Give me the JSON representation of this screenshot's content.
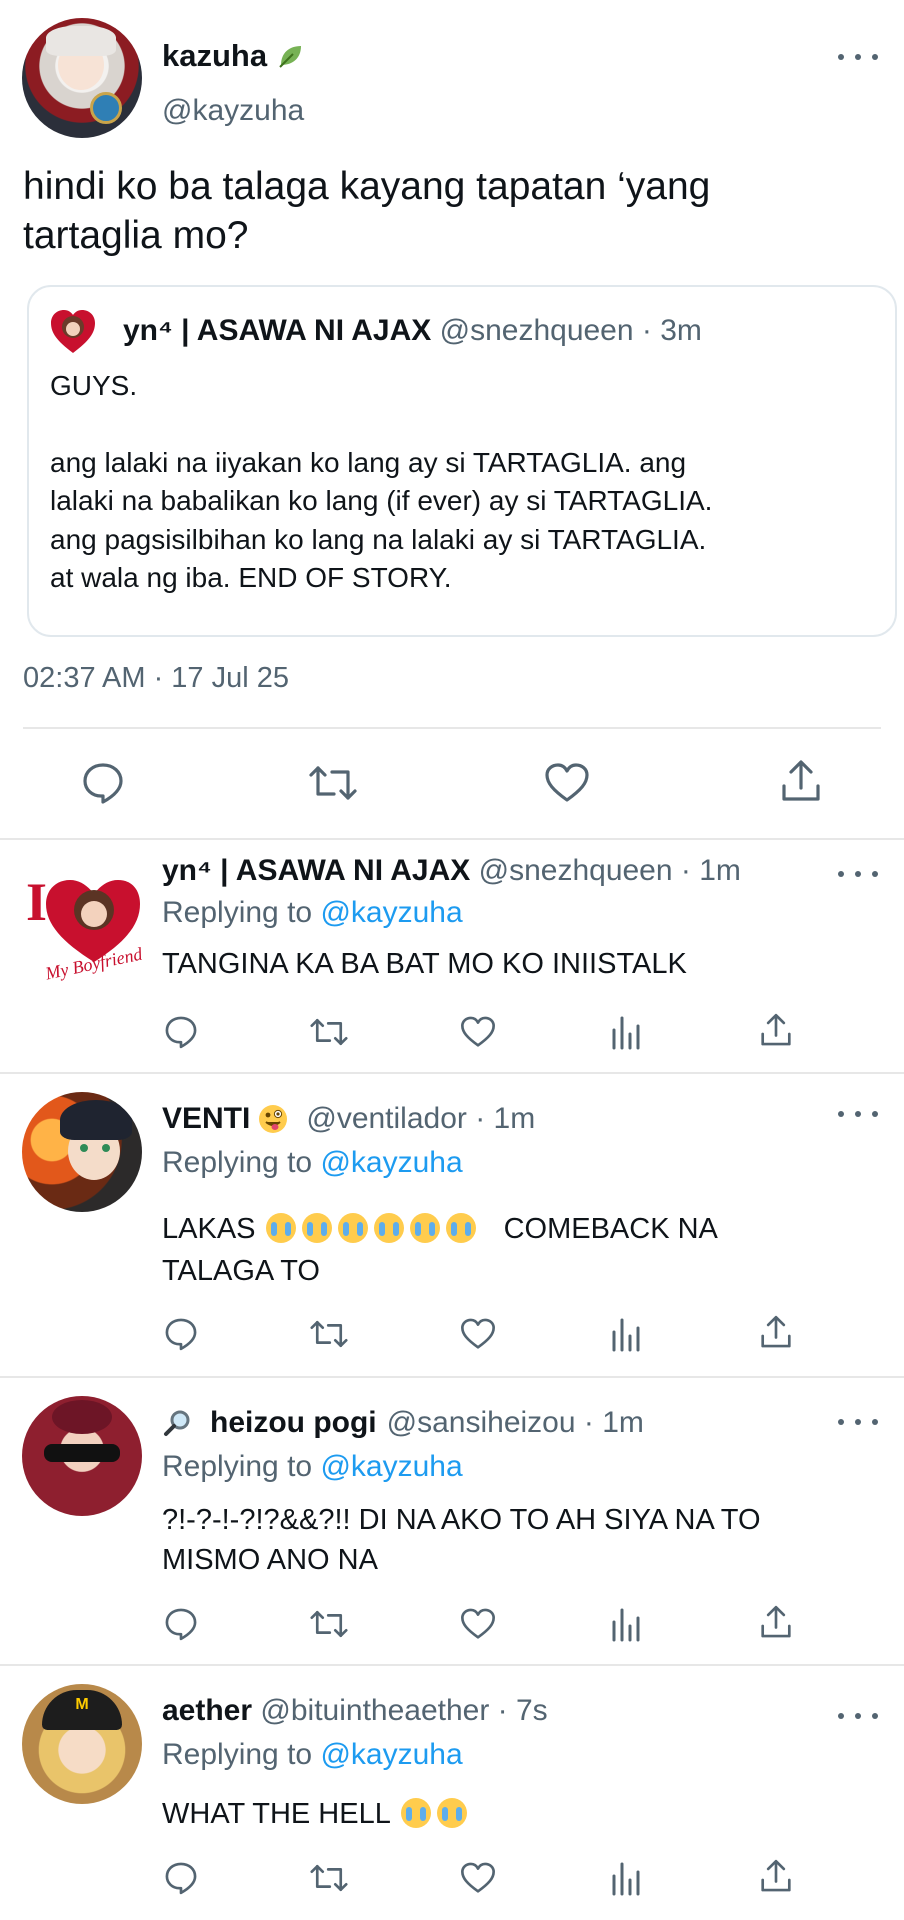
{
  "main_tweet": {
    "name": "kazuha",
    "handle": "@kayzuha",
    "text_line1": "hindi ko ba talaga kayang tapatan ‘yang",
    "text_line2": "tartaglia mo?",
    "timestamp": "02:37 AM · 17 Jul 25",
    "quote": {
      "name": "yn⁴ | ASAWA NI AJAX",
      "handle_time": "@snezhqueen · 3m",
      "line1": "GUYS.",
      "line2": "ang lalaki na iiyakan ko lang ay si TARTAGLIA. ang",
      "line3": "lalaki na babalikan ko lang (if ever) ay si TARTAGLIA.",
      "line4": "ang pagsisilbihan ko lang na lalaki ay si TARTAGLIA.",
      "line5": "at wala ng iba. END OF STORY."
    }
  },
  "replies": [
    {
      "name": "yn⁴ | ASAWA NI AJAX",
      "handle_time": "@snezhqueen · 1m",
      "replying_prefix": "Replying to",
      "replying_handle": "@kayzuha",
      "line1": "TANGINA KA BA BAT MO KO INIISTALK"
    },
    {
      "name": "VENTI",
      "handle_time": "@ventilador · 1m",
      "replying_prefix": "Replying to",
      "replying_handle": "@kayzuha",
      "line1_a": "LAKAS",
      "line1_b": "COMEBACK NA",
      "line2": "TALAGA TO"
    },
    {
      "name": "heizou pogi",
      "handle_time": "@sansiheizou · 1m",
      "replying_prefix": "Replying to",
      "replying_handle": "@kayzuha",
      "line1": "?!-?-!-?!?&&?!! DI NA AKO TO AH SIYA NA TO",
      "line2": "MISMO ANO NA"
    },
    {
      "name": "aether",
      "handle_time": "@bituintheaether · 7s",
      "replying_prefix": "Replying to",
      "replying_handle": "@kayzuha",
      "line1": "WHAT THE HELL"
    }
  ],
  "icons": {
    "reply": "reply-icon",
    "retweet": "retweet-icon",
    "like": "heart-icon",
    "views": "analytics-icon",
    "share": "share-icon",
    "more": "more-icon",
    "leaf": "leaf-icon",
    "magnifier": "magnifier-icon",
    "emoji": "loudly-crying-face-icon"
  },
  "colors": {
    "link": "#1d9bf0",
    "muted": "#536471",
    "text": "#0f1419",
    "divider": "#e7e7e7"
  }
}
